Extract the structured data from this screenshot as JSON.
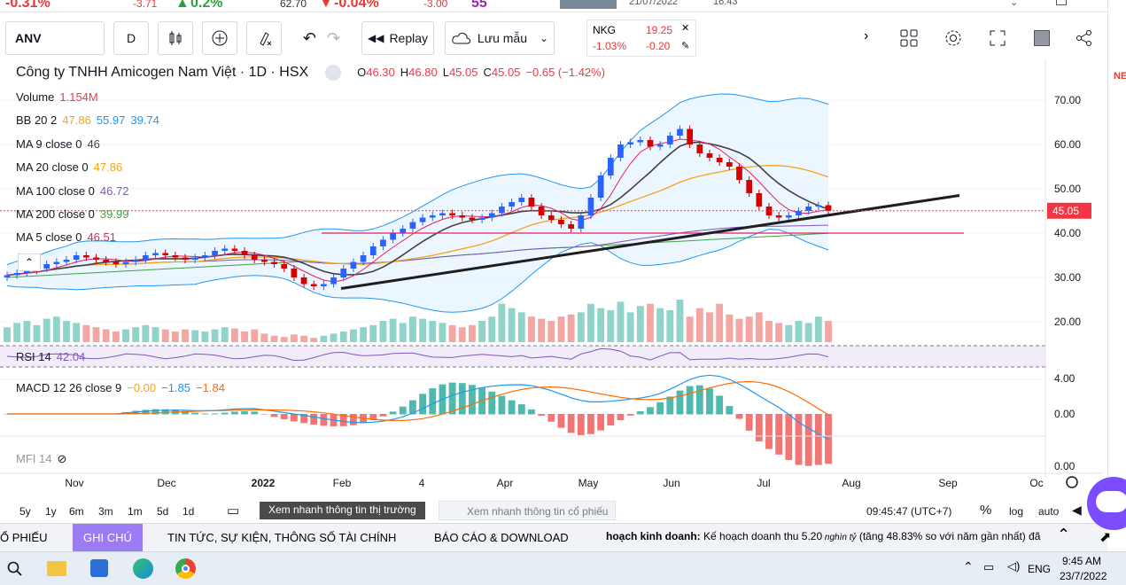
{
  "ticker": [
    {
      "text": "-0.31%",
      "color": "#e53935"
    },
    {
      "text": "-3.71",
      "color": "#e53935"
    },
    {
      "text": "0.2%",
      "color": "#2e9e3e"
    },
    {
      "text": "62.70",
      "color": "#333333"
    },
    {
      "text": "-0.04%",
      "color": "#e53935"
    },
    {
      "text": "-3.00",
      "color": "#e53935"
    },
    {
      "text": "55",
      "color": "#9c27b0"
    },
    {
      "text": "21/07/2022",
      "color": "#555555"
    },
    {
      "text": "16:43",
      "color": "#555555"
    }
  ],
  "toolbar": {
    "symbol": "ANV",
    "interval": "D",
    "replay_label": "Replay",
    "save_label": "Lưu mẫu",
    "compare": {
      "symbol": "NKG",
      "price": "19.25",
      "pct": "-1.03%",
      "change": "-0.20"
    }
  },
  "legend": {
    "title": "Công ty TNHH Amicogen Nam Việt · 1D · HSX",
    "ohlc": {
      "o_label": "O",
      "o": "46.30",
      "h_label": "H",
      "h": "46.80",
      "l_label": "L",
      "l": "45.05",
      "c_label": "C",
      "c": "45.05",
      "chg": "−0.65 (−1.42%)"
    },
    "volume": {
      "label": "Volume",
      "value": "1.154M"
    },
    "bb": {
      "label": "BB 20 2",
      "v1": "47.86",
      "v2": "55.97",
      "v3": "39.74"
    },
    "ma9": {
      "label": "MA 9 close 0",
      "value": "46"
    },
    "ma20": {
      "label": "MA 20 close 0",
      "value": "47.86"
    },
    "ma100": {
      "label": "MA 100 close 0",
      "value": "46.72"
    },
    "ma200": {
      "label": "MA 200 close 0",
      "value": "39.99"
    },
    "ma5": {
      "label": "MA 5 close 0",
      "value": "46.51"
    },
    "rsi": {
      "label": "RSI 14",
      "value": "42.04"
    },
    "macd": {
      "label": "MACD 12 26 close 9",
      "v1": "−0.00",
      "v2": "−1.85",
      "v3": "−1.84"
    },
    "mfi": {
      "label": "MFI 14"
    }
  },
  "colors": {
    "up": "#26a69a",
    "down": "#ef5350",
    "candle_up": "#2962ff",
    "candle_down": "#d50000",
    "bb": "#2196f3",
    "ma9": "#424242",
    "ma20": "#f7a21b",
    "ma100": "#7e57c2",
    "ma200": "#43a047",
    "ma5": "#e91e63",
    "rsi": "#7e57c2",
    "macd": "#2196f3",
    "signal": "#ff6d00",
    "last_price": "#f23645"
  },
  "chart_data": {
    "type": "candlestick",
    "x_ticks": [
      "Nov",
      "Dec",
      "2022",
      "Feb",
      "4",
      "Apr",
      "May",
      "Jun",
      "Jul",
      "Aug",
      "Sep",
      "Oc"
    ],
    "price_axis_ticks": [
      "70.00",
      "60.00",
      "50.00",
      "40.00",
      "30.00",
      "20.00"
    ],
    "price_range": [
      15.5,
      77.5
    ],
    "last_price": "45.05",
    "macd_axis_ticks": [
      "4.00",
      "0.00",
      "0.00"
    ],
    "close_series": [
      30.5,
      31,
      31.5,
      32,
      33,
      33.5,
      34,
      35,
      34.5,
      34,
      33.5,
      33,
      33.5,
      34,
      35,
      35.5,
      35,
      34.5,
      34,
      34.5,
      35,
      36,
      36.5,
      36,
      35,
      34,
      33.5,
      33,
      32,
      30,
      28.5,
      28,
      28.5,
      30,
      32,
      33.5,
      35,
      37,
      38.5,
      40,
      41,
      42.5,
      43.5,
      44,
      44.5,
      44,
      43.5,
      43,
      43.5,
      44.5,
      46,
      47,
      48,
      46,
      44,
      43,
      42,
      41,
      44,
      48,
      53,
      57,
      60,
      60.5,
      61,
      59.5,
      60,
      62,
      63.5,
      60,
      58,
      57,
      56,
      55,
      52,
      49,
      46,
      44,
      43.5,
      44,
      45,
      46,
      46.3,
      45.05
    ],
    "volume_relative": [
      0.35,
      0.45,
      0.5,
      0.4,
      0.55,
      0.6,
      0.5,
      0.45,
      0.4,
      0.35,
      0.3,
      0.25,
      0.3,
      0.35,
      0.4,
      0.35,
      0.3,
      0.25,
      0.3,
      0.28,
      0.25,
      0.3,
      0.35,
      0.32,
      0.25,
      0.3,
      0.2,
      0.15,
      0.12,
      0.18,
      0.15,
      0.1,
      0.15,
      0.2,
      0.25,
      0.3,
      0.35,
      0.4,
      0.5,
      0.55,
      0.45,
      0.6,
      0.55,
      0.5,
      0.45,
      0.4,
      0.35,
      0.4,
      0.5,
      0.6,
      0.9,
      0.8,
      0.7,
      0.6,
      0.55,
      0.5,
      0.6,
      0.65,
      0.7,
      0.9,
      0.8,
      0.75,
      0.95,
      0.7,
      0.85,
      0.9,
      0.8,
      0.75,
      1.0,
      0.6,
      0.8,
      0.7,
      0.9,
      0.65,
      0.55,
      0.6,
      0.7,
      0.5,
      0.45,
      0.4,
      0.5,
      0.45,
      0.6,
      0.5
    ]
  },
  "range_buttons": [
    "5y",
    "1y",
    "6m",
    "3m",
    "1m",
    "5d",
    "1d"
  ],
  "quick_view_label": "Xem nhanh thông tin thị trường",
  "search_placeholder": "Xem nhanh thông tin cổ phiếu",
  "clock_label": "09:45:47 (UTC+7)",
  "scale_buttons": {
    "pct": "%",
    "log": "log",
    "auto": "auto"
  },
  "bottom_tabs": [
    "Ổ PHIẾU",
    "GHI CHÚ",
    "TIN TỨC, SỰ KIỆN, THÔNG SỐ TÀI CHÍNH",
    "BÁO CÁO & DOWNLOAD"
  ],
  "news_text": {
    "bold": "hoạch kinh doanh:",
    "normal": " Kế hoạch doanh thu 5.20",
    "italic": " nghìn tỷ",
    "rest": " (tăng 48.83% so với năm gần nhất) đã"
  },
  "taskbar": {
    "lang": "ENG",
    "time": "9:45 AM",
    "date": "23/7/2022"
  },
  "side_label": "NE"
}
